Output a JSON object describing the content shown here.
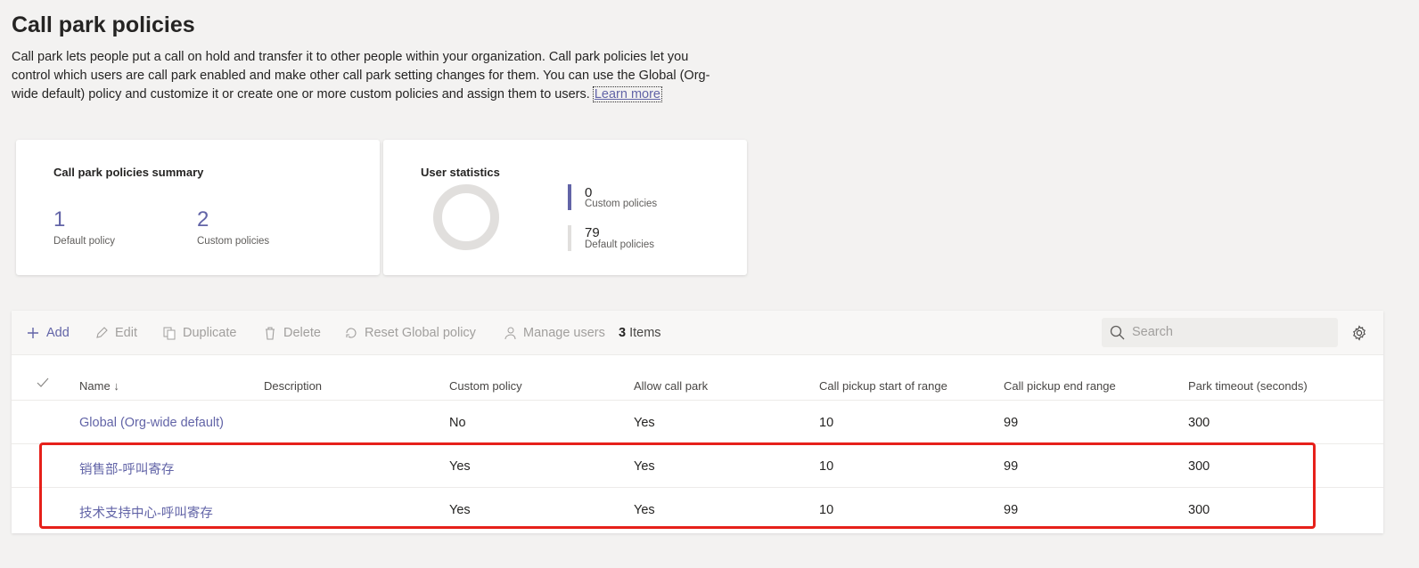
{
  "page": {
    "title": "Call park policies",
    "intro": "Call park lets people put a call on hold and transfer it to other people within your organization. Call park policies let you control which users are call park enabled and make other call park setting changes for them. You can use the Global (Org-wide default) policy and customize it or create one or more custom policies and assign them to users.",
    "learn_more": "Learn more"
  },
  "summary_card": {
    "title": "Call park policies summary",
    "default_count": "1",
    "default_label": "Default policy",
    "custom_count": "2",
    "custom_label": "Custom policies"
  },
  "stats_card": {
    "title": "User statistics",
    "custom_count": "0",
    "custom_label": "Custom policies",
    "default_count": "79",
    "default_label": "Default policies",
    "colors": {
      "custom": "#6264a7",
      "default": "#e1dfdd"
    }
  },
  "toolbar": {
    "add": "Add",
    "edit": "Edit",
    "duplicate": "Duplicate",
    "delete": "Delete",
    "reset": "Reset Global policy",
    "manage": "Manage users",
    "count_num": "3",
    "count_label": "Items",
    "search_placeholder": "Search"
  },
  "table": {
    "columns": [
      "Name",
      "Description",
      "Custom policy",
      "Allow call park",
      "Call pickup start of range",
      "Call pickup end range",
      "Park timeout (seconds)"
    ],
    "rows": [
      {
        "name": "Global (Org-wide default)",
        "description": "",
        "custom": "No",
        "allow": "Yes",
        "start": "10",
        "end": "99",
        "timeout": "300"
      },
      {
        "name": "销售部-呼叫寄存",
        "description": "",
        "custom": "Yes",
        "allow": "Yes",
        "start": "10",
        "end": "99",
        "timeout": "300"
      },
      {
        "name": "技术支持中心-呼叫寄存",
        "description": "",
        "custom": "Yes",
        "allow": "Yes",
        "start": "10",
        "end": "99",
        "timeout": "300"
      }
    ]
  },
  "colors": {
    "accent": "#6264a7",
    "highlight": "#e6201a"
  }
}
